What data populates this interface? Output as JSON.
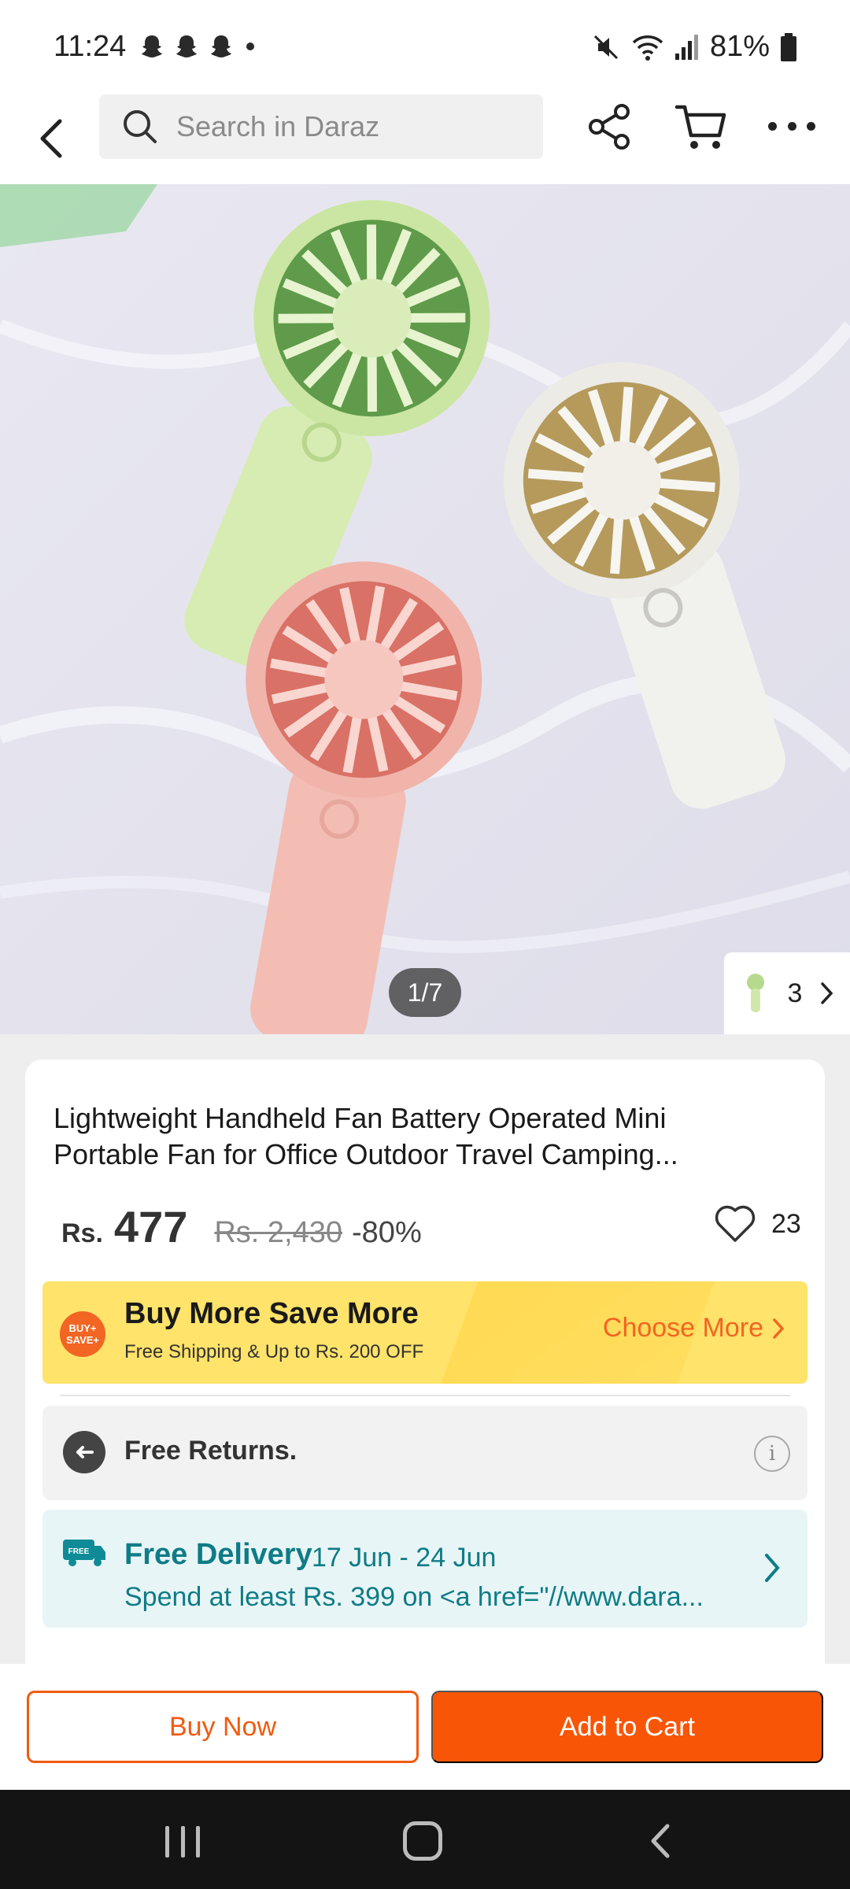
{
  "status_bar": {
    "time": "11:24",
    "battery": "81%",
    "notification_icons": [
      "snapchat-icon",
      "snapchat-icon",
      "snapchat-icon",
      "dot"
    ]
  },
  "top_bar": {
    "search_placeholder": "Search in Daraz"
  },
  "image": {
    "counter": "1/7",
    "variant_count": "3"
  },
  "product": {
    "title": "Lightweight Handheld Fan Battery Operated Mini Portable Fan for Office Outdoor Travel Camping...",
    "currency": "Rs.",
    "price": "477",
    "original_price": "Rs. 2,430",
    "discount": "-80%",
    "wishlist_count": "23"
  },
  "promo": {
    "badge_line1": "BUY+",
    "badge_line2": "SAVE+",
    "title": "Buy More Save More",
    "subtitle": "Free Shipping & Up to Rs. 200 OFF",
    "cta": "Choose More"
  },
  "returns": {
    "label": "Free Returns."
  },
  "delivery": {
    "title": "Free Delivery",
    "dates": "17 Jun - 24 Jun",
    "subtitle": "Spend at least Rs. 399 on <a href=\"//www.dara...",
    "icon_text": "FREE"
  },
  "actions": {
    "buy_now": "Buy Now",
    "add_to_cart": "Add to Cart"
  },
  "colors": {
    "brand_orange": "#f85606",
    "promo_yellow": "#ffe36a",
    "delivery_teal": "#0e7c86"
  }
}
